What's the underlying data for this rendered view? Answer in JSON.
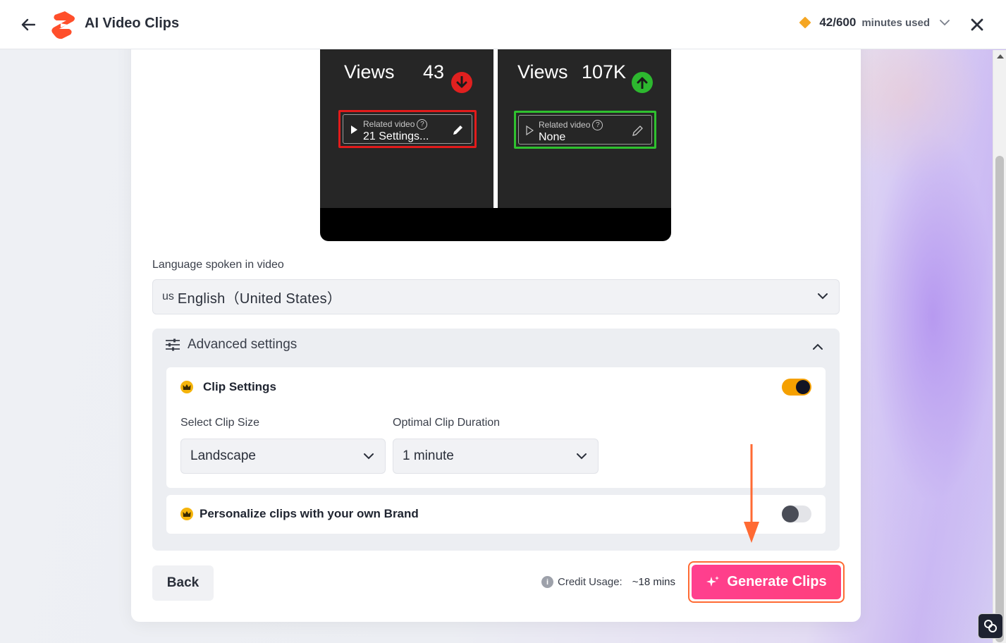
{
  "header": {
    "title": "AI Video Clips",
    "usage_count": "42/600",
    "usage_suffix": "minutes used"
  },
  "preview": {
    "left": {
      "views_label": "Views",
      "views_value": "43",
      "related_label": "Related video",
      "related_value": "21 Settings..."
    },
    "right": {
      "views_label": "Views",
      "views_value": "107K",
      "related_label": "Related video",
      "related_value": "None"
    }
  },
  "language": {
    "label": "Language spoken in video",
    "country_code": "us",
    "value": "English（United States）"
  },
  "advanced": {
    "title": "Advanced settings",
    "clip_settings": {
      "title": "Clip Settings",
      "enabled": true,
      "size_label": "Select Clip Size",
      "size_value": "Landscape",
      "duration_label": "Optimal Clip Duration",
      "duration_value": "1 minute"
    },
    "brand": {
      "title": "Personalize clips with your own Brand",
      "enabled": false
    }
  },
  "footer": {
    "back_label": "Back",
    "credit_label": "Credit Usage:",
    "credit_value": "~18 mins",
    "generate_label": "Generate Clips"
  },
  "colors": {
    "accent_pink": "#ff3f8f",
    "highlight_orange": "#ff6a33",
    "toggle_on": "#f5a000",
    "views_down": "#e0201f",
    "views_up": "#2db82f"
  },
  "icons": {
    "back": "arrow-left-icon",
    "logo": "app-logo-icon",
    "usage": "diamond-icon",
    "close": "close-icon",
    "settings": "sliders-icon",
    "premium": "crown-icon",
    "generate": "sparkle-icon",
    "info": "info-icon"
  }
}
